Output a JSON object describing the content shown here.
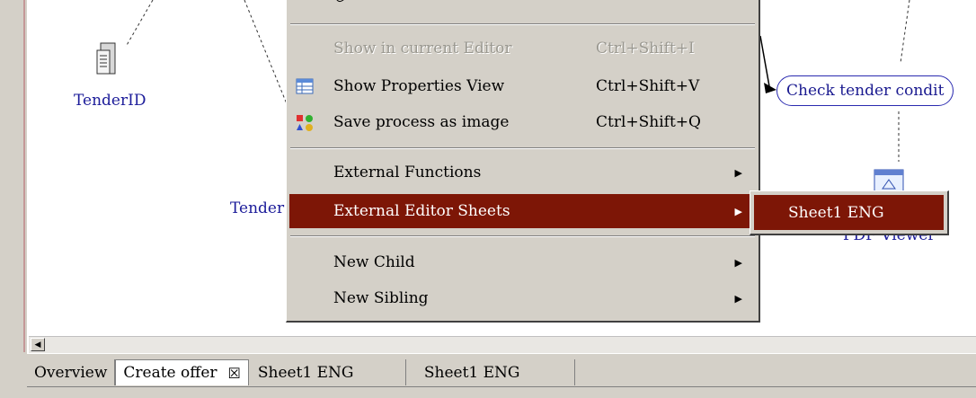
{
  "canvas": {
    "nodes": {
      "tender_id_label": "TenderID",
      "tender_partial_label": "Tender",
      "check_tender_label": "Check tender condit",
      "pdf_viewer_partial_label": "PDF Viewer"
    },
    "icons": {
      "database": "database-icon",
      "pdf": "pdf-document-icon"
    }
  },
  "context_menu": {
    "items": [
      {
        "label": "Show in current Editor",
        "accel": "Ctrl+Shift+I",
        "enabled": false
      },
      {
        "label": "Show Properties View",
        "accel": "Ctrl+Shift+V",
        "enabled": true,
        "icon": "properties-table-icon"
      },
      {
        "label": "Save process as image",
        "accel": "Ctrl+Shift+Q",
        "enabled": true,
        "icon": "shapes-image-icon"
      },
      {
        "label": "External Functions",
        "has_submenu": true
      },
      {
        "label": "External Editor Sheets",
        "has_submenu": true,
        "selected": true
      },
      {
        "label": "New Child",
        "has_submenu": true
      },
      {
        "label": "New Sibling",
        "has_submenu": true
      }
    ]
  },
  "submenu": {
    "items": [
      {
        "label": "Sheet1 ENG",
        "selected": true
      }
    ]
  },
  "tabs": [
    {
      "label": "Overview"
    },
    {
      "label": "Create offer",
      "active": true,
      "closable": true
    },
    {
      "label": "Sheet1 ENG"
    },
    {
      "label": "Sheet1 ENG"
    }
  ],
  "colors": {
    "selection": "#7d1606",
    "menu_bg": "#d4d0c8",
    "node_text": "#1c1c9a"
  }
}
